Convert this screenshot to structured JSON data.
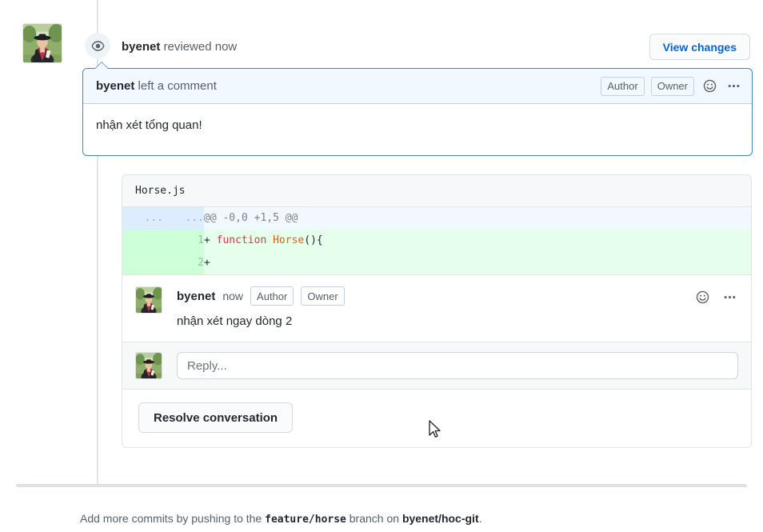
{
  "review": {
    "author": "byenet",
    "action_text": "reviewed",
    "timestamp": "now",
    "eye_icon": "eye-icon",
    "view_changes_label": "View changes"
  },
  "main_comment": {
    "author": "byenet",
    "action_text": "left a comment",
    "badges": [
      "Author",
      "Owner"
    ],
    "reaction_icon": "smiley-icon",
    "menu_icon": "kebab-menu-icon",
    "body": "nhận xét tổng quan!"
  },
  "diff": {
    "filename": "Horse.js",
    "rows": [
      {
        "type": "hunk",
        "old_line": "...",
        "new_line": "...",
        "content": "@@ -0,0 +1,5 @@"
      },
      {
        "type": "add",
        "old_line": "",
        "new_line": "1",
        "marker": "+",
        "tokens": [
          {
            "text": "function ",
            "cls": "k-red"
          },
          {
            "text": "Horse",
            "cls": "k-orange"
          },
          {
            "text": "(){",
            "cls": ""
          }
        ]
      },
      {
        "type": "add",
        "old_line": "",
        "new_line": "2",
        "marker": "+",
        "tokens": []
      }
    ]
  },
  "inline_comment": {
    "author": "byenet",
    "timestamp": "now",
    "badges": [
      "Author",
      "Owner"
    ],
    "reaction_icon": "smiley-icon",
    "menu_icon": "kebab-menu-icon",
    "body": "nhận xét ngay dòng 2"
  },
  "reply": {
    "placeholder": "Reply...",
    "value": ""
  },
  "resolve": {
    "label": "Resolve conversation"
  },
  "footer": {
    "prefix": "Add more commits by pushing to the",
    "branch": "feature/horse",
    "middle": "branch on",
    "repo": "byenet/hoc-git",
    "suffix": "."
  },
  "colors": {
    "accent_blue": "#0366d6",
    "comment_border": "#4183c4",
    "comment_head_bg": "#f1f8ff",
    "diff_add_bg": "#e6ffed",
    "diff_add_gutter": "#cdffd8",
    "diff_hunk_bg": "#f1f8ff",
    "diff_hunk_gutter": "#dbedff",
    "keyword_red": "#d73a49",
    "function_orange": "#e36209",
    "border_gray": "#e1e4e8",
    "muted_text": "#586069"
  }
}
